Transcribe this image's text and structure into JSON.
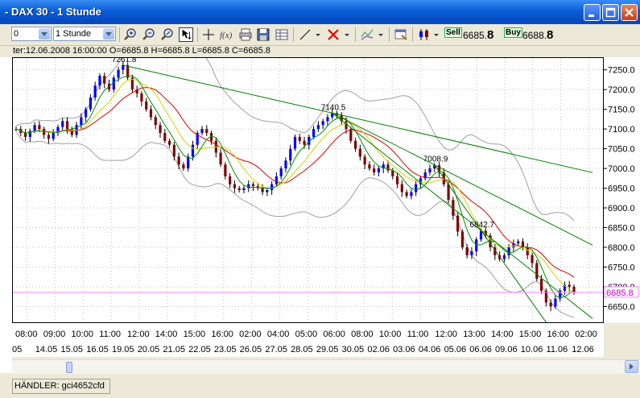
{
  "window": {
    "title": "- DAX 30 - 1 Stunde"
  },
  "toolbar": {
    "symbol_combo": "0",
    "interval_combo": "1 Stunde"
  },
  "trade": {
    "sell_label": "Sell",
    "sell_price_main": "6685.",
    "sell_price_big": "8",
    "buy_label": "Buy",
    "buy_price_main": "6688.",
    "buy_price_big": "8"
  },
  "info_line": "ter:12.06.2008 16:00:00 O=6685.8 H=6685.8 L=6685.8 C=6685.8",
  "status": {
    "text": "HÄNDLER: gci4652cfd"
  },
  "colors": {
    "title_bar": "#0a5fd6",
    "candle_up": "#0000ff",
    "candle_down": "#800000",
    "trendline": "#008000",
    "ma_red": "#e00000",
    "ma_yellow": "#d4d400",
    "ma_green": "#009000",
    "bollinger": "#a0a0a0",
    "current_price_line": "#ff80ff"
  },
  "chart_data": {
    "type": "candlestick",
    "ylim": [
      6610,
      7280
    ],
    "y_ticks": [
      6650,
      6700,
      6750,
      6800,
      6850,
      6900,
      6950,
      7000,
      7050,
      7100,
      7150,
      7200,
      7250
    ],
    "y_tick_labels": [
      "6650.0",
      "6700.0",
      "6750.0",
      "6800.0",
      "6850.0",
      "6900.0",
      "6950.0",
      "7000.0",
      "7050.0",
      "7100.0",
      "7150.0",
      "7200.0",
      "7250.0"
    ],
    "current_price": 6685.8,
    "current_price_label": "6685.8",
    "x_time_labels": [
      "08:00",
      "09:00",
      "10:00",
      "11:00",
      "12:00",
      "14:00",
      "15:00",
      "16:00",
      "02:00",
      "04:00",
      "05:00",
      "06:00",
      "08:00",
      "10:00",
      "11:00",
      "12:00",
      "13:00",
      "14:00",
      "15:00",
      "16:00",
      "02:00"
    ],
    "x_date_labels": [
      ".05",
      "14.05",
      "15.05",
      "16.05",
      "19.05",
      "20.05",
      "21.05",
      "22.05",
      "23.05",
      "26.05",
      "27.05",
      "28.05",
      "29.05",
      "30.05",
      "02.06",
      "03.06",
      "04.06",
      "05.06",
      "06.06",
      "09.06",
      "10.06",
      "11.06",
      "12.06"
    ],
    "annotations": [
      {
        "text": "7261.8",
        "value": 7261.8
      },
      {
        "text": "7140.5",
        "value": 7140.5
      },
      {
        "text": "7008.9",
        "value": 7008.9
      },
      {
        "text": "6842.7",
        "value": 6842.7
      }
    ],
    "close_path": [
      7100,
      7090,
      7080,
      7095,
      7110,
      7100,
      7085,
      7075,
      7090,
      7105,
      7120,
      7100,
      7085,
      7110,
      7130,
      7150,
      7180,
      7210,
      7235,
      7215,
      7200,
      7230,
      7250,
      7262,
      7230,
      7200,
      7190,
      7170,
      7150,
      7130,
      7110,
      7090,
      7070,
      7060,
      7030,
      7010,
      7000,
      7030,
      7060,
      7090,
      7100,
      7090,
      7070,
      7040,
      7010,
      6980,
      6960,
      6950,
      6945,
      6950,
      6960,
      6955,
      6950,
      6940,
      6945,
      6960,
      6980,
      7000,
      7020,
      7050,
      7080,
      7070,
      7060,
      7080,
      7100,
      7110,
      7120,
      7130,
      7140,
      7135,
      7120,
      7100,
      7070,
      7050,
      7030,
      7010,
      7000,
      6990,
      7000,
      7010,
      6995,
      6980,
      6960,
      6940,
      6930,
      6940,
      6960,
      6975,
      6990,
      7000,
      7008,
      6990,
      6960,
      6920,
      6880,
      6840,
      6800,
      6780,
      6790,
      6820,
      6842,
      6830,
      6800,
      6780,
      6770,
      6780,
      6800,
      6810,
      6815,
      6800,
      6780,
      6760,
      6720,
      6690,
      6660,
      6650,
      6670,
      6690,
      6705,
      6700,
      6685.8
    ]
  }
}
